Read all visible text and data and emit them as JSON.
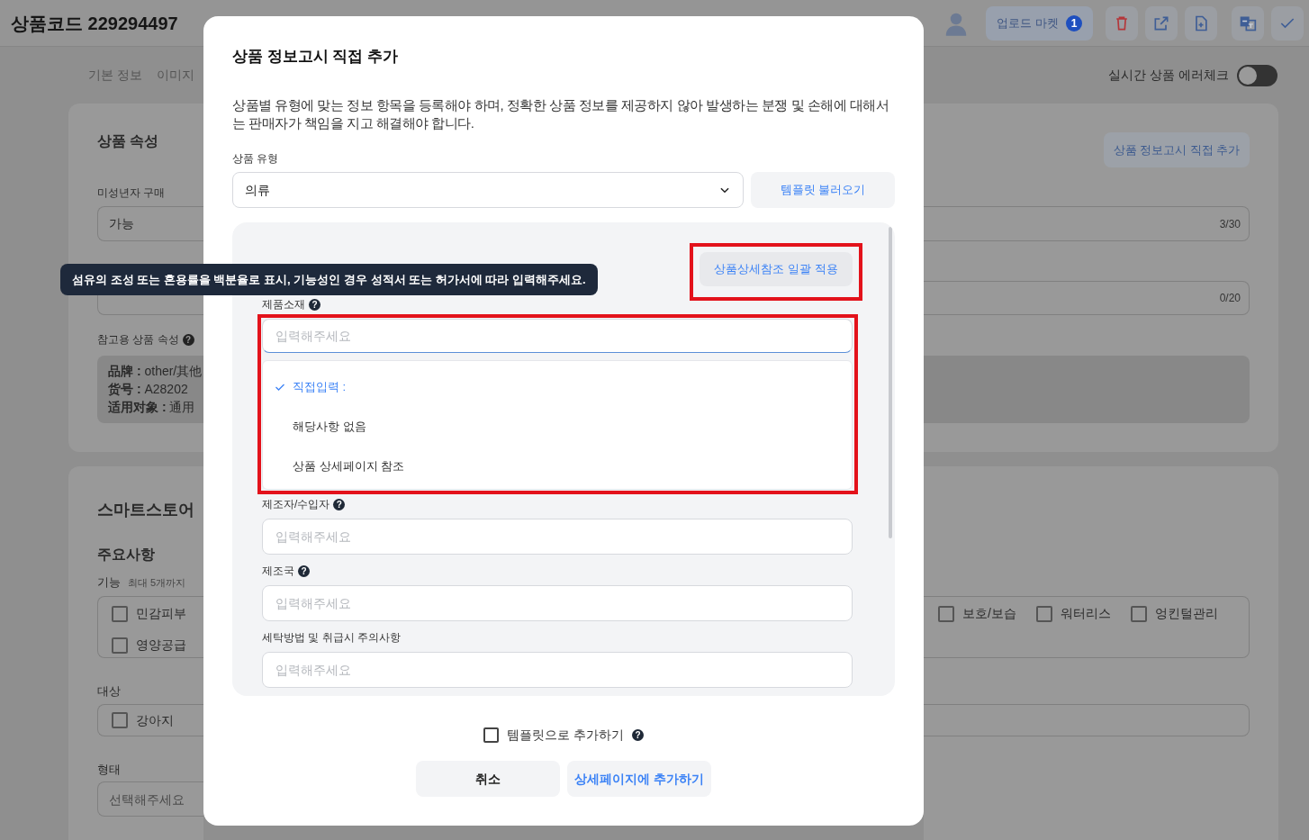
{
  "header": {
    "title": "상품코드 229294497",
    "upload_button": {
      "label": "업로드 마켓",
      "count": "1"
    },
    "tool_buttons": [
      {
        "kind": "delete"
      },
      {
        "kind": "external"
      },
      {
        "kind": "add-file"
      },
      {
        "kind": "translate"
      },
      {
        "kind": "confirm"
      }
    ]
  },
  "tabs": [
    {
      "label": "기본 정보"
    },
    {
      "label": "이미지"
    }
  ],
  "error_check": {
    "label": "실시간 상품 에러체크",
    "on": false
  },
  "attributes_section": {
    "title": "상품 속성",
    "add_notice_button": "상품 정보고시 직접 추가",
    "minor_purchase": {
      "label": "미성년자 구매",
      "value": "가능",
      "counter": "3/30"
    },
    "brand": {
      "counter": "0/20"
    },
    "reference": {
      "label": "참고용 상품 속성",
      "help": "?",
      "lines": [
        "**品牌 :** other/其他",
        "**货号 :** A28202",
        "**适用对象 :** 通用"
      ]
    }
  },
  "smartstore_section": {
    "title": "스마트스토어",
    "main_title": "주요사항",
    "function": {
      "label": "기능",
      "hint": "최대 5개까지",
      "left_options": [
        {
          "label": "민감피부",
          "checked": false
        },
        {
          "label": "영양공급",
          "checked": false
        }
      ],
      "right_options": [
        {
          "label": "보호/보습",
          "checked": false
        },
        {
          "label": "워터리스",
          "checked": false
        },
        {
          "label": "엉킨털관리",
          "checked": false
        }
      ]
    },
    "target": {
      "label": "대상",
      "options": [
        {
          "label": "강아지",
          "checked": false
        }
      ]
    },
    "form": {
      "label": "형태",
      "placeholder": "선택해주세요"
    }
  },
  "dialog": {
    "title": "상품 정보고시 직접 추가",
    "description": "상품별 유형에 맞는 정보 항목을 등록해야 하며, 정확한 상품 정보를 제공하지 않아 발생하는 분쟁 및 손해에 대해서는 판매자가 책임을 지고 해결해야 합니다.",
    "type_field": {
      "label": "상품 유형",
      "value": "의류"
    },
    "template_button": "템플릿 불러오기",
    "bulk_button": {
      "label": "상품상세참조 일괄 적용",
      "highlighted": true
    },
    "fields": [
      {
        "label": "제품소재",
        "help": "?",
        "placeholder": "입력해주세요",
        "highlighted": true,
        "options": [
          {
            "label": "직접입력 :",
            "selected": true
          },
          {
            "label": "해당사항 없음",
            "selected": false
          },
          {
            "label": "상품 상세페이지 참조",
            "selected": false
          }
        ]
      },
      {
        "label": "제조자/수입자",
        "help": "?",
        "placeholder": "입력해주세요"
      },
      {
        "label": "제조국",
        "help": "?",
        "placeholder": "입력해주세요"
      },
      {
        "label": "세탁방법 및 취급시 주의사항",
        "placeholder": "입력해주세요"
      }
    ],
    "save_template": {
      "label": "템플릿으로 추가하기",
      "help": "?",
      "checked": false
    },
    "cancel_button": "취소",
    "submit_button": "상세페이지에 추가하기"
  },
  "tooltip": "섬유의 조성 또는 혼용률을 백분율로 표시, 기능성인 경우 성적서 또는 허가서에 따라 입력해주세요."
}
